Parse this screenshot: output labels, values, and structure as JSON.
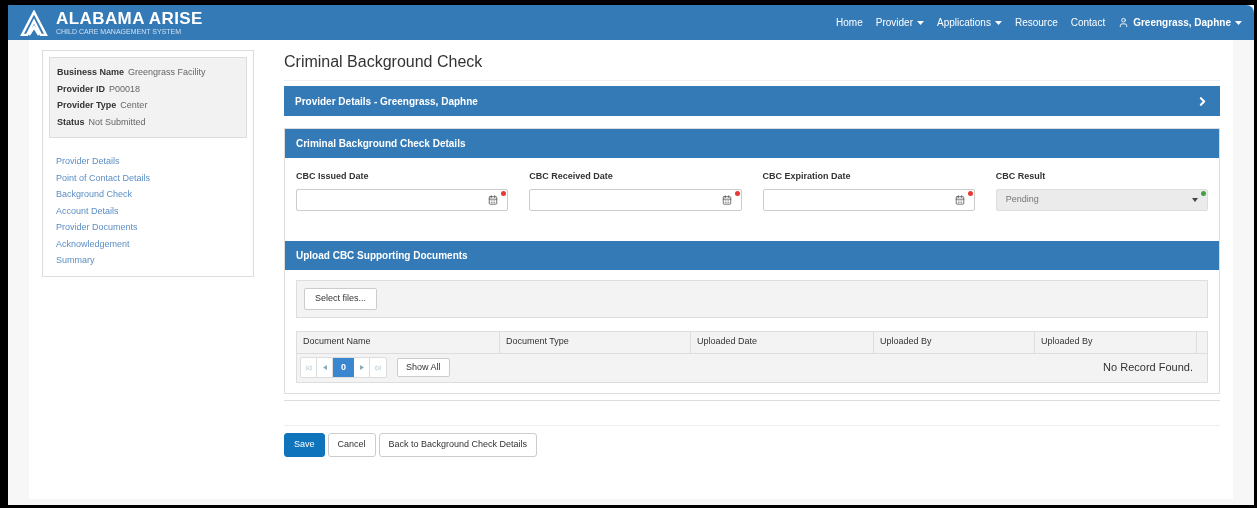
{
  "header": {
    "logo_title": "ALABAMA ARISE",
    "logo_subtitle": "CHILD CARE MANAGEMENT SYSTEM",
    "nav": [
      {
        "label": "Home",
        "dropdown": false
      },
      {
        "label": "Provider",
        "dropdown": true
      },
      {
        "label": "Applications",
        "dropdown": true
      },
      {
        "label": "Resource",
        "dropdown": false
      },
      {
        "label": "Contact",
        "dropdown": false
      }
    ],
    "user": "Greengrass, Daphne"
  },
  "summary": [
    {
      "label": "Business Name",
      "value": "Greengrass Facility"
    },
    {
      "label": "Provider ID",
      "value": "P00018"
    },
    {
      "label": "Provider Type",
      "value": "Center"
    },
    {
      "label": "Status",
      "value": "Not Submitted"
    }
  ],
  "sidebar": {
    "items": [
      "Provider Details",
      "Point of Contact Details",
      "Background Check",
      "Account Details",
      "Provider Documents",
      "Acknowledgement",
      "Summary"
    ]
  },
  "page_title": "Criminal Background Check",
  "provider_panel": {
    "title": "Provider Details - Greengrass, Daphne",
    "expanded": false
  },
  "details_panel": {
    "title": "Criminal Background Check Details",
    "fields": [
      {
        "label": "CBC Issued Date",
        "kind": "date",
        "disabled": false,
        "color": "#e53935"
      },
      {
        "label": "CBC Received Date",
        "kind": "date",
        "disabled": false,
        "color": "#e53935"
      },
      {
        "label": "CBC Expiration Date",
        "kind": "date",
        "disabled": false,
        "color": "#e53935"
      },
      {
        "label": "CBC Result",
        "kind": "select",
        "value": "Pending",
        "disabled": true,
        "color": "#43a047"
      }
    ]
  },
  "upload_panel": {
    "title": "Upload CBC Supporting Documents",
    "select_button": "Select files...",
    "table": {
      "columns": [
        "Document Name",
        "Document Type",
        "Uploaded Date",
        "Uploaded By",
        "Uploaded By"
      ],
      "pager": {
        "pages": [
          {
            "label": "0",
            "selected": true
          }
        ],
        "show_all": "Show All"
      },
      "empty_message": "No Record Found."
    }
  },
  "actions": [
    {
      "label": "Save",
      "kind": "primary"
    },
    {
      "label": "Cancel",
      "kind": "default"
    },
    {
      "label": "Back to Background Check Details",
      "kind": "default"
    }
  ]
}
